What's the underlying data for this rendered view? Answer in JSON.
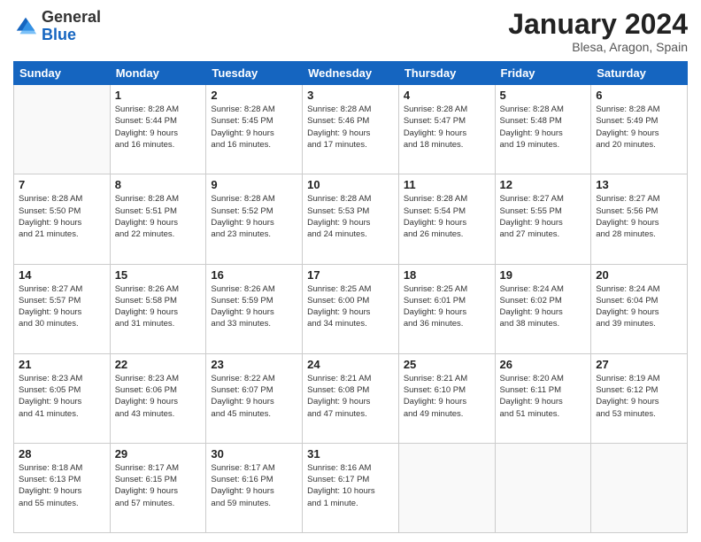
{
  "logo": {
    "general": "General",
    "blue": "Blue"
  },
  "header": {
    "title": "January 2024",
    "subtitle": "Blesa, Aragon, Spain"
  },
  "weekdays": [
    "Sunday",
    "Monday",
    "Tuesday",
    "Wednesday",
    "Thursday",
    "Friday",
    "Saturday"
  ],
  "weeks": [
    [
      {
        "day": "",
        "info": ""
      },
      {
        "day": "1",
        "info": "Sunrise: 8:28 AM\nSunset: 5:44 PM\nDaylight: 9 hours\nand 16 minutes."
      },
      {
        "day": "2",
        "info": "Sunrise: 8:28 AM\nSunset: 5:45 PM\nDaylight: 9 hours\nand 16 minutes."
      },
      {
        "day": "3",
        "info": "Sunrise: 8:28 AM\nSunset: 5:46 PM\nDaylight: 9 hours\nand 17 minutes."
      },
      {
        "day": "4",
        "info": "Sunrise: 8:28 AM\nSunset: 5:47 PM\nDaylight: 9 hours\nand 18 minutes."
      },
      {
        "day": "5",
        "info": "Sunrise: 8:28 AM\nSunset: 5:48 PM\nDaylight: 9 hours\nand 19 minutes."
      },
      {
        "day": "6",
        "info": "Sunrise: 8:28 AM\nSunset: 5:49 PM\nDaylight: 9 hours\nand 20 minutes."
      }
    ],
    [
      {
        "day": "7",
        "info": "Sunrise: 8:28 AM\nSunset: 5:50 PM\nDaylight: 9 hours\nand 21 minutes."
      },
      {
        "day": "8",
        "info": "Sunrise: 8:28 AM\nSunset: 5:51 PM\nDaylight: 9 hours\nand 22 minutes."
      },
      {
        "day": "9",
        "info": "Sunrise: 8:28 AM\nSunset: 5:52 PM\nDaylight: 9 hours\nand 23 minutes."
      },
      {
        "day": "10",
        "info": "Sunrise: 8:28 AM\nSunset: 5:53 PM\nDaylight: 9 hours\nand 24 minutes."
      },
      {
        "day": "11",
        "info": "Sunrise: 8:28 AM\nSunset: 5:54 PM\nDaylight: 9 hours\nand 26 minutes."
      },
      {
        "day": "12",
        "info": "Sunrise: 8:27 AM\nSunset: 5:55 PM\nDaylight: 9 hours\nand 27 minutes."
      },
      {
        "day": "13",
        "info": "Sunrise: 8:27 AM\nSunset: 5:56 PM\nDaylight: 9 hours\nand 28 minutes."
      }
    ],
    [
      {
        "day": "14",
        "info": "Sunrise: 8:27 AM\nSunset: 5:57 PM\nDaylight: 9 hours\nand 30 minutes."
      },
      {
        "day": "15",
        "info": "Sunrise: 8:26 AM\nSunset: 5:58 PM\nDaylight: 9 hours\nand 31 minutes."
      },
      {
        "day": "16",
        "info": "Sunrise: 8:26 AM\nSunset: 5:59 PM\nDaylight: 9 hours\nand 33 minutes."
      },
      {
        "day": "17",
        "info": "Sunrise: 8:25 AM\nSunset: 6:00 PM\nDaylight: 9 hours\nand 34 minutes."
      },
      {
        "day": "18",
        "info": "Sunrise: 8:25 AM\nSunset: 6:01 PM\nDaylight: 9 hours\nand 36 minutes."
      },
      {
        "day": "19",
        "info": "Sunrise: 8:24 AM\nSunset: 6:02 PM\nDaylight: 9 hours\nand 38 minutes."
      },
      {
        "day": "20",
        "info": "Sunrise: 8:24 AM\nSunset: 6:04 PM\nDaylight: 9 hours\nand 39 minutes."
      }
    ],
    [
      {
        "day": "21",
        "info": "Sunrise: 8:23 AM\nSunset: 6:05 PM\nDaylight: 9 hours\nand 41 minutes."
      },
      {
        "day": "22",
        "info": "Sunrise: 8:23 AM\nSunset: 6:06 PM\nDaylight: 9 hours\nand 43 minutes."
      },
      {
        "day": "23",
        "info": "Sunrise: 8:22 AM\nSunset: 6:07 PM\nDaylight: 9 hours\nand 45 minutes."
      },
      {
        "day": "24",
        "info": "Sunrise: 8:21 AM\nSunset: 6:08 PM\nDaylight: 9 hours\nand 47 minutes."
      },
      {
        "day": "25",
        "info": "Sunrise: 8:21 AM\nSunset: 6:10 PM\nDaylight: 9 hours\nand 49 minutes."
      },
      {
        "day": "26",
        "info": "Sunrise: 8:20 AM\nSunset: 6:11 PM\nDaylight: 9 hours\nand 51 minutes."
      },
      {
        "day": "27",
        "info": "Sunrise: 8:19 AM\nSunset: 6:12 PM\nDaylight: 9 hours\nand 53 minutes."
      }
    ],
    [
      {
        "day": "28",
        "info": "Sunrise: 8:18 AM\nSunset: 6:13 PM\nDaylight: 9 hours\nand 55 minutes."
      },
      {
        "day": "29",
        "info": "Sunrise: 8:17 AM\nSunset: 6:15 PM\nDaylight: 9 hours\nand 57 minutes."
      },
      {
        "day": "30",
        "info": "Sunrise: 8:17 AM\nSunset: 6:16 PM\nDaylight: 9 hours\nand 59 minutes."
      },
      {
        "day": "31",
        "info": "Sunrise: 8:16 AM\nSunset: 6:17 PM\nDaylight: 10 hours\nand 1 minute."
      },
      {
        "day": "",
        "info": ""
      },
      {
        "day": "",
        "info": ""
      },
      {
        "day": "",
        "info": ""
      }
    ]
  ]
}
